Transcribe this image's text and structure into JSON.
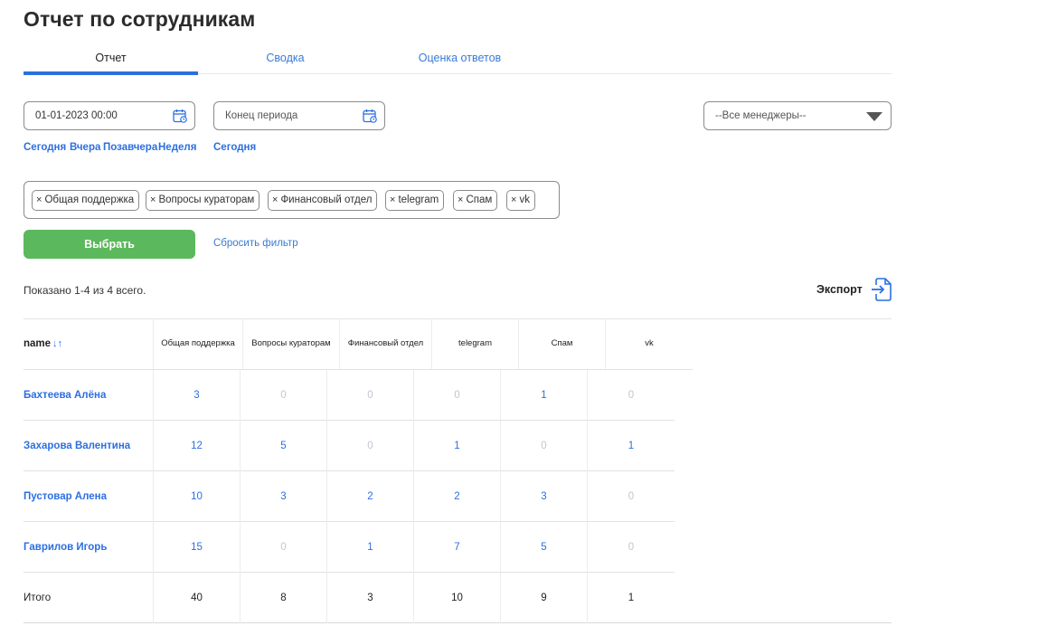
{
  "page": {
    "title": "Отчет по сотрудникам"
  },
  "tabs": [
    {
      "label": "Отчет",
      "active": true
    },
    {
      "label": "Сводка",
      "active": false
    },
    {
      "label": "Оценка ответов",
      "active": false
    }
  ],
  "filters": {
    "date_from": {
      "value": "01-01-2023 00:00",
      "icon": "calendar-icon"
    },
    "date_to": {
      "placeholder": "Конец периода",
      "icon": "calendar-icon"
    },
    "date_from_quick": [
      "Сегодня",
      "Вчера",
      "Позавчера",
      "Неделя"
    ],
    "date_to_quick": [
      "Сегодня"
    ],
    "managers": {
      "selected": "--Все менеджеры--"
    },
    "tags": [
      "Общая поддержка",
      "Вопросы кураторам",
      "Финансовый отдел",
      "telegram",
      "Спам",
      "vk"
    ],
    "tag_remove_symbol": "×",
    "submit_label": "Выбрать",
    "reset_label": "Сбросить фильтр"
  },
  "summary": "Показано 1-4 из 4 всего.",
  "export": {
    "label": "Экспорт",
    "icon": "export-file-icon"
  },
  "table": {
    "name_header": "name",
    "sort_symbol": "↓↑",
    "columns": [
      "Общая поддержка",
      "Вопросы кураторам",
      "Финансовый отдел",
      "telegram",
      "Спам",
      "vk"
    ],
    "rows": [
      {
        "name": "Бахтеева Алёна",
        "values": [
          "3",
          "0",
          "0",
          "0",
          "1",
          "0"
        ]
      },
      {
        "name": "Захарова Валентина",
        "values": [
          "12",
          "5",
          "0",
          "1",
          "0",
          "1"
        ]
      },
      {
        "name": "Пустовар Алена",
        "values": [
          "10",
          "3",
          "2",
          "2",
          "3",
          "0"
        ]
      },
      {
        "name": "Гаврилов Игорь",
        "values": [
          "15",
          "0",
          "1",
          "7",
          "5",
          "0"
        ]
      }
    ],
    "total": {
      "name": "Итого",
      "values": [
        "40",
        "8",
        "3",
        "10",
        "9",
        "1"
      ]
    }
  },
  "colors": {
    "accent": "#2c6fe0",
    "button_green": "#5cb85c",
    "zero_value": "#c0c6cf"
  }
}
